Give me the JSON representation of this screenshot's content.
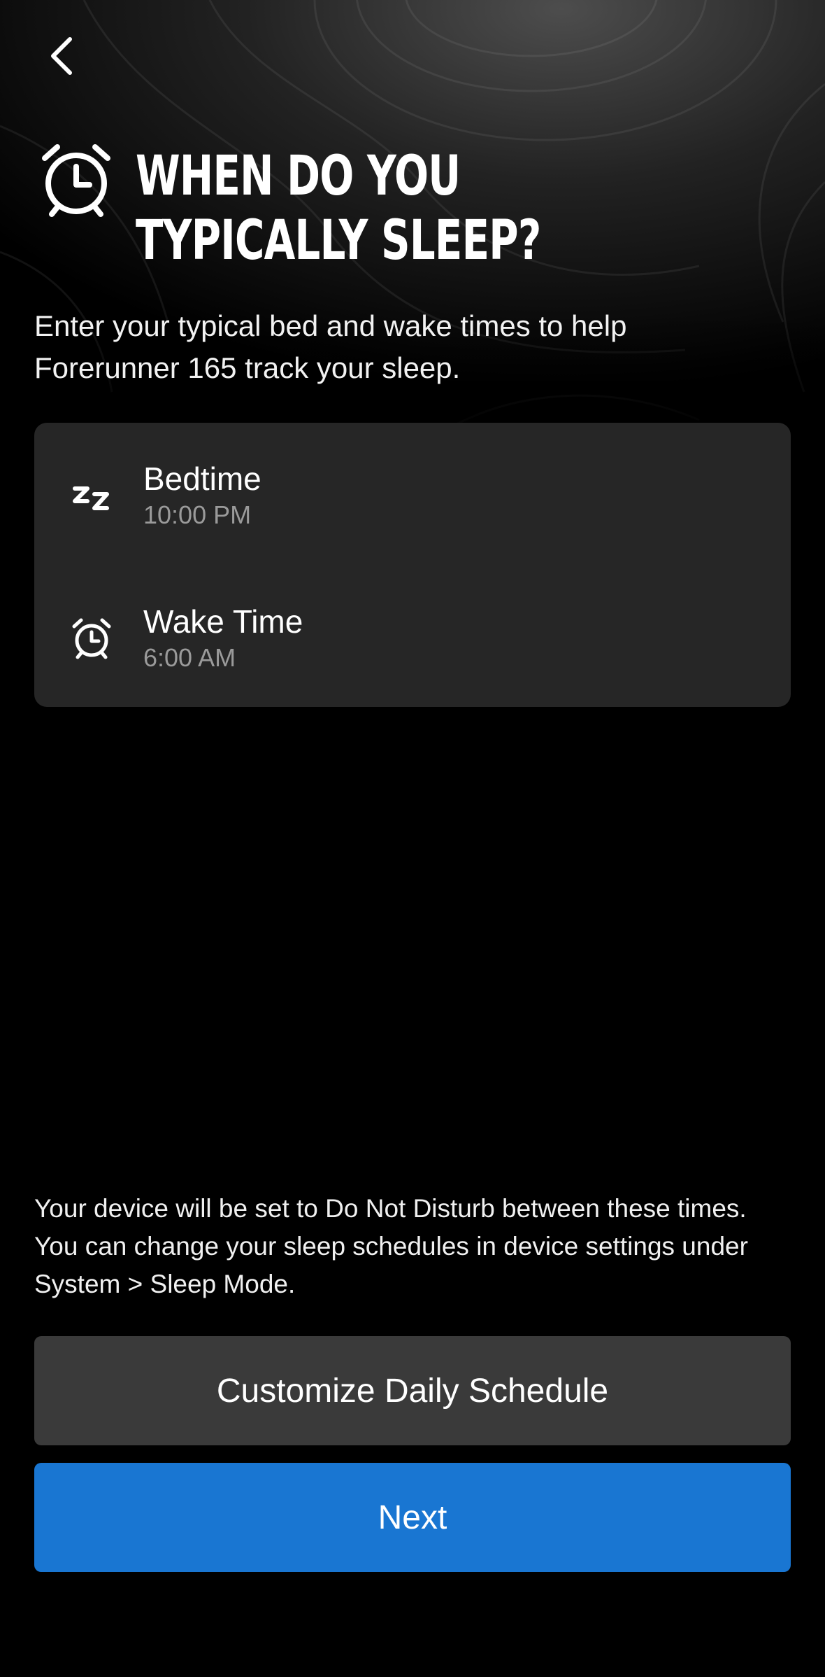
{
  "header": {
    "back_icon": "chevron-left-icon",
    "title_icon": "alarm-clock-icon",
    "title_lines": [
      "When do you",
      "typically sleep?"
    ]
  },
  "intro": {
    "text": "Enter your typical bed and wake times to help Forerunner 165 track your sleep."
  },
  "schedule": {
    "bedtime": {
      "icon": "zzz-icon",
      "label": "Bedtime",
      "value": "10:00 PM"
    },
    "wake": {
      "icon": "alarm-clock-icon",
      "label": "Wake Time",
      "value": "6:00 AM"
    }
  },
  "footnote": {
    "text": "Your device will be set to Do Not Disturb between these times. You can change your sleep schedules in device settings under System > Sleep Mode."
  },
  "actions": {
    "customize_label": "Customize Daily Schedule",
    "next_label": "Next"
  },
  "colors": {
    "background": "#000000",
    "card": "#262626",
    "secondary_button": "#3a3a3a",
    "primary_button": "#1976d2",
    "muted_text": "#9a9a9a"
  }
}
